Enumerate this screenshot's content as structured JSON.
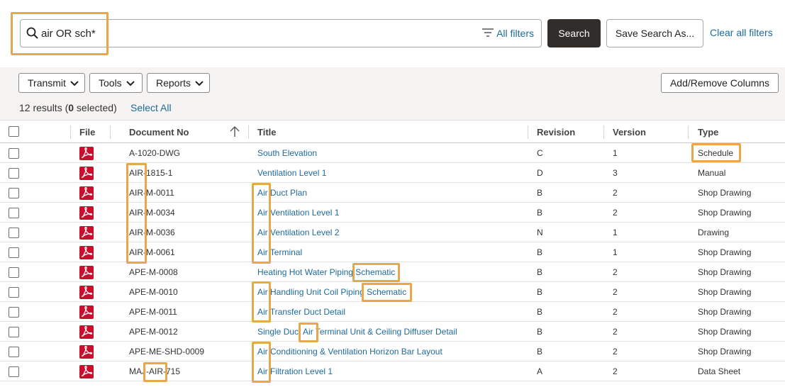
{
  "search": {
    "query": "air OR sch*",
    "all_filters": "All filters",
    "search_button": "Search",
    "save_search_button": "Save Search As...",
    "clear_filters": "Clear all filters"
  },
  "toolbar": {
    "transmit": "Transmit",
    "tools": "Tools",
    "reports": "Reports",
    "add_remove_columns": "Add/Remove Columns"
  },
  "results": {
    "count_prefix": "12 results (",
    "selected": "0",
    "count_suffix": " selected)",
    "select_all": "Select All"
  },
  "columns": {
    "file": "File",
    "document_no": "Document No",
    "title": "Title",
    "revision": "Revision",
    "version": "Version",
    "type": "Type"
  },
  "rows": [
    {
      "doc": "A-1020-DWG",
      "title": "South Elevation",
      "rev": "C",
      "ver": "1",
      "type": "Schedule"
    },
    {
      "doc": "AIR-1815-1",
      "title": "Ventilation Level 1",
      "rev": "D",
      "ver": "3",
      "type": "Manual"
    },
    {
      "doc": "AIR-M-0011",
      "title": "Air Duct Plan",
      "rev": "B",
      "ver": "2",
      "type": "Shop Drawing"
    },
    {
      "doc": "AIR-M-0034",
      "title": "Air Ventilation Level 1",
      "rev": "B",
      "ver": "2",
      "type": "Shop Drawing"
    },
    {
      "doc": "AIR-M-0036",
      "title": "Air Ventilation Level 2",
      "rev": "N",
      "ver": "1",
      "type": "Drawing"
    },
    {
      "doc": "AIR-M-0061",
      "title": "Air Terminal",
      "rev": "B",
      "ver": "1",
      "type": "Shop Drawing"
    },
    {
      "doc": "APE-M-0008",
      "title": "Heating Hot Water Piping Schematic",
      "rev": "B",
      "ver": "2",
      "type": "Shop Drawing"
    },
    {
      "doc": "APE-M-0010",
      "title": "Air Handling Unit Coil Piping Schematic",
      "rev": "B",
      "ver": "2",
      "type": "Shop Drawing"
    },
    {
      "doc": "APE-M-0011",
      "title": "Air Transfer Duct Detail",
      "rev": "B",
      "ver": "2",
      "type": "Shop Drawing"
    },
    {
      "doc": "APE-M-0012",
      "title": "Single Duct Air Terminal Unit & Ceiling Diffuser Detail",
      "rev": "B",
      "ver": "2",
      "type": "Shop Drawing"
    },
    {
      "doc": "APE-ME-SHD-0009",
      "title": "Air Conditioning & Ventilation Horizon Bar Layout",
      "rev": "B",
      "ver": "2",
      "type": "Shop Drawing"
    },
    {
      "doc": "MAJ-AIR-715",
      "title": "Air Filtration Level 1",
      "rev": "A",
      "ver": "2",
      "type": "Data Sheet"
    }
  ],
  "icons": {
    "search": "search-icon",
    "filter": "filter-icon",
    "pdf": "pdf-file-icon",
    "chevron": "chevron-down-icon",
    "sort": "sort-ascending-icon"
  },
  "colors": {
    "link": "#1e6b9b",
    "highlight": "#e8a849",
    "primary_button": "#312d2a",
    "pdf_red": "#c8102e"
  }
}
